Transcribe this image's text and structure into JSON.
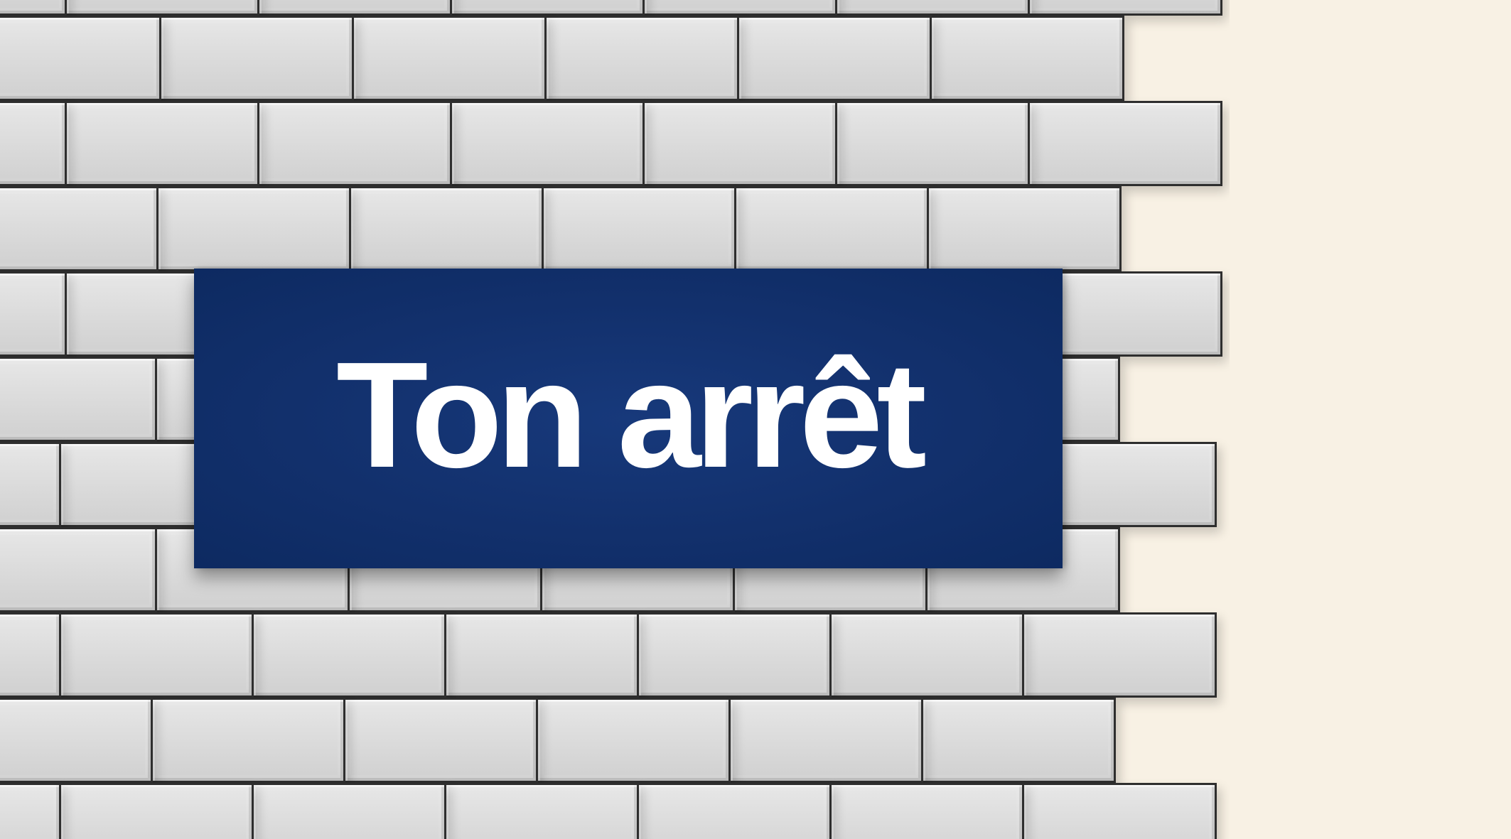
{
  "sign": {
    "text": "Ton arrêt",
    "background_color": "#12306c",
    "text_color": "#ffffff"
  },
  "wall": {
    "tile_color": "#dcdcdc",
    "grout_color": "#2e2e2e"
  },
  "page": {
    "background_color": "#f8f1e4"
  }
}
